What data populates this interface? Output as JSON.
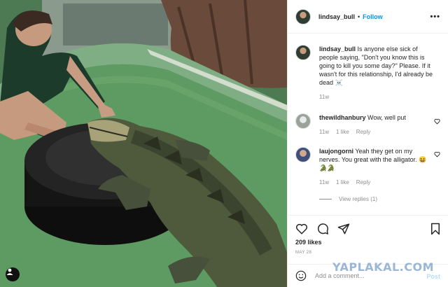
{
  "post": {
    "username": "lindsay_bull",
    "dot": "•",
    "follow_label": "Follow",
    "more_label": "•••"
  },
  "caption": {
    "username": "lindsay_bull",
    "text": "Is anyone else sick of people saying, \"Don't you know this is going to kill you some day?\" Please. If it wasn't for this relationship, I'd already be dead ☠️",
    "age": "11w"
  },
  "comments": [
    {
      "username": "thewildhanbury",
      "text": "Wow, well put",
      "age": "11w",
      "likes": "1 like",
      "reply_label": "Reply"
    },
    {
      "username": "laujongorni",
      "text": "Yeah they get on my nerves. You great with the alligator. 😆🐊🐊",
      "age": "11w",
      "likes": "1 like",
      "reply_label": "Reply"
    }
  ],
  "view_replies_label": "View replies (1)",
  "likes_count": "209 likes",
  "date": "MAY 28",
  "add_comment": {
    "placeholder": "Add a comment...",
    "post_label": "Post"
  },
  "watermark": "YAPLAKAL.COM",
  "icons": [
    "heart-icon",
    "comment-icon",
    "share-icon",
    "bookmark-icon",
    "emoji-icon",
    "user-tag-icon"
  ],
  "colors": {
    "accent": "#0095f6",
    "muted": "#8e8e8e",
    "border": "#efefef"
  }
}
